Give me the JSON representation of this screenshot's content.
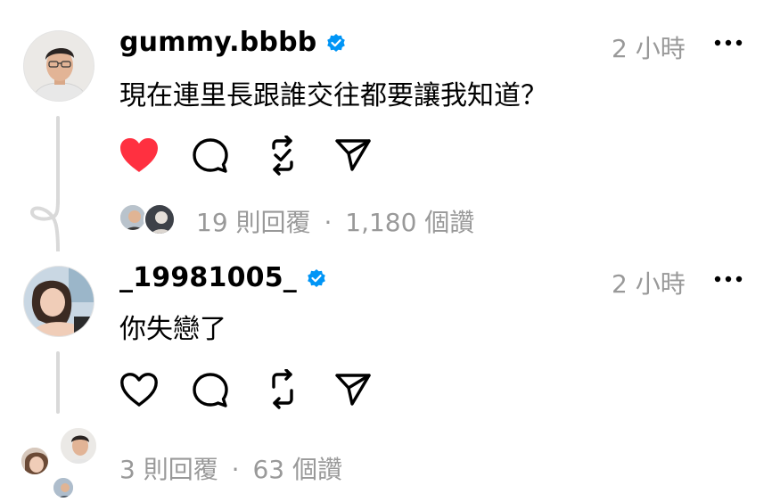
{
  "posts": [
    {
      "username": "gummy.bbbb",
      "verified": true,
      "time": "2 小時",
      "text": "現在連里長跟誰交往都要讓我知道？",
      "liked": true,
      "reply_count_text": "19 則回覆",
      "like_count_text": "1,180 個讚",
      "separator": "·"
    },
    {
      "username": "_19981005_",
      "verified": true,
      "time": "2 小時",
      "text": "你失戀了",
      "liked": false,
      "reply_count_text": "3 則回覆",
      "like_count_text": "63 個讚",
      "separator": "·"
    }
  ],
  "colors": {
    "like_red": "#ff3040",
    "verified_blue": "#0095f6",
    "muted_gray": "#999999"
  }
}
